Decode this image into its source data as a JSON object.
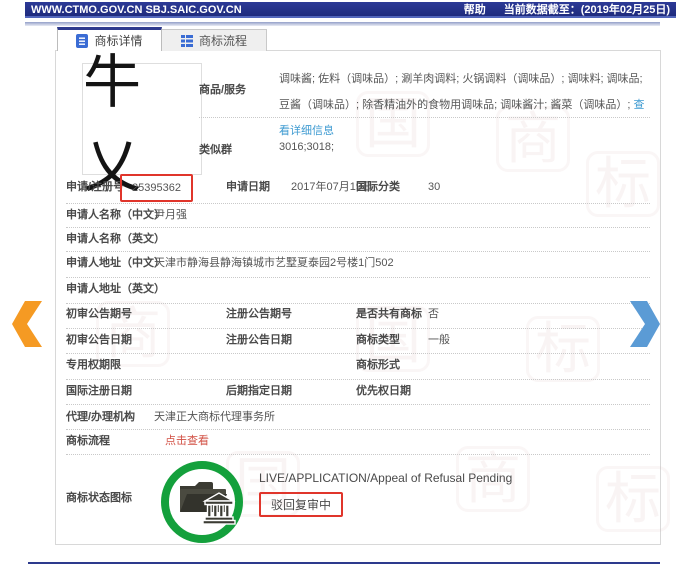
{
  "topbar": {
    "site_urls": "WWW.CTMO.GOV.CN SBJ.SAIC.GOV.CN",
    "help_label": "帮助",
    "data_cutoff": "当前数据截至：(2019年02月25日)"
  },
  "tabs": [
    {
      "label": "商标详情",
      "active": true
    },
    {
      "label": "商标流程",
      "active": false
    }
  ],
  "trademark": {
    "image_text": "牛乂"
  },
  "detail": {
    "goods_label": "商品/服务",
    "goods_text": "调味酱; 佐料（调味品）; 涮羊肉调料; 火锅调料（调味品）; 调味料; 调味品; 豆酱（调味品）; 除香精油外的食物用调味品; 调味酱汁; 酱菜（调味品）; ",
    "goods_more_link": "查看详细信息",
    "similar_group_label": "类似群",
    "similar_group_value": "3016;3018;",
    "reg_no_label": "申请/注册号",
    "reg_no_value": "25395362",
    "apply_date_label": "申请日期",
    "apply_date_value": "2017年07月19日",
    "intl_class_label": "国际分类",
    "intl_class_value": "30",
    "applicant_cn_label": "申请人名称（中文）",
    "applicant_cn_value": "尹月强",
    "applicant_en_label": "申请人名称（英文）",
    "applicant_en_value": "",
    "addr_cn_label": "申请人地址（中文）",
    "addr_cn_value": "天津市静海县静海镇城市艺墅夏泰园2号楼1门502",
    "addr_en_label": "申请人地址（英文）",
    "addr_en_value": "",
    "first_pub_no_label": "初审公告期号",
    "first_pub_no_value": "",
    "reg_pub_no_label": "注册公告期号",
    "reg_pub_no_value": "",
    "shared_label": "是否共有商标",
    "shared_value": "否",
    "first_pub_date_label": "初审公告日期",
    "first_pub_date_value": "",
    "reg_pub_date_label": "注册公告日期",
    "reg_pub_date_value": "",
    "type_label": "商标类型",
    "type_value": "一般",
    "term_label": "专用权期限",
    "term_value": "",
    "form_label": "商标形式",
    "form_value": "",
    "intl_reg_date_label": "国际注册日期",
    "intl_reg_date_value": "",
    "later_date_label": "后期指定日期",
    "later_date_value": "",
    "priority_date_label": "优先权日期",
    "priority_date_value": "",
    "agent_label": "代理/办理机构",
    "agent_value": "天津正大商标代理事务所",
    "process_label": "商标流程",
    "process_link": "点击查看",
    "status_label": "商标状态图标",
    "status_en": "LIVE/APPLICATION/Appeal of Refusal Pending",
    "status_cn": "驳回复审中"
  },
  "watermarks": [
    "国",
    "商",
    "标"
  ],
  "colors": {
    "topbar_blue": "#232e87",
    "tab_accent_blue": "#2e3a8e",
    "link_blue": "#3d9ad1",
    "link_red": "#d24f43",
    "highlight_red": "#e0352b",
    "status_green": "#14a03c",
    "arrow_orange": "#f59a23",
    "arrow_blue": "#5b9bd5"
  }
}
